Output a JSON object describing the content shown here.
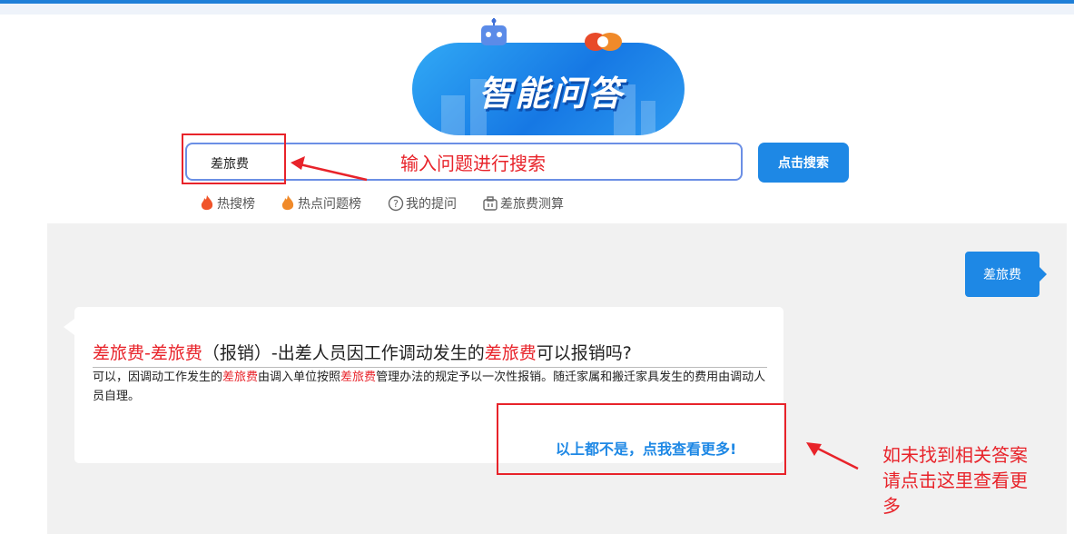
{
  "banner": {
    "title": "智能问答"
  },
  "search": {
    "value": "差旅费",
    "button_label": "点击搜索"
  },
  "annotations": {
    "input_hint": "输入问题进行搜索",
    "more_hint": "如未找到相关答案请点击这里查看更多"
  },
  "quick_links": [
    {
      "label": "热搜榜",
      "icon": "flame-icon"
    },
    {
      "label": "热点问题榜",
      "icon": "flame-icon"
    },
    {
      "label": "我的提问",
      "icon": "question-circle-icon"
    },
    {
      "label": "差旅费测算",
      "icon": "briefcase-icon"
    }
  ],
  "chat": {
    "user_message": "差旅费",
    "answer": {
      "title_part1": "差旅费-差旅费",
      "title_part2": "（报销）-出差人员因工作调动发生的",
      "title_part3": "差旅费",
      "title_part4": "可以报销吗?",
      "body_part1": "可以，因调动工作发生的",
      "body_part2": "差旅费",
      "body_part3": "由调入单位按照",
      "body_part4": "差旅费",
      "body_part5": "管理办法的规定予以一次性报销。随迁家属和搬迁家具发生的费用由调动人员自理。"
    },
    "more_link": "以上都不是，点我查看更多!"
  },
  "colors": {
    "accent": "#1e88e5",
    "annotation_red": "#e8232a",
    "panel_bg": "#f1f1f1"
  }
}
